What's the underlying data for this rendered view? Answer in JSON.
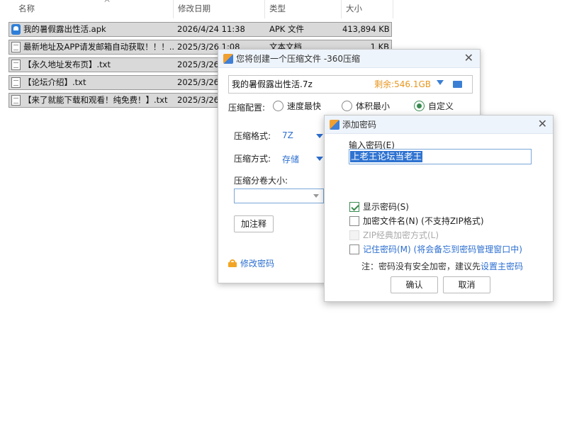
{
  "explorer": {
    "columns": {
      "name": "名称",
      "modified": "修改日期",
      "type": "类型",
      "size": "大小"
    },
    "sort_caret": "^",
    "files": [
      {
        "icon": "apk-file-icon",
        "name": "我的暑假露出性活.apk",
        "modified": "2026/4/24 11:38",
        "type": "APK 文件",
        "size": "413,894 KB"
      },
      {
        "icon": "text-file-icon",
        "name": "最新地址及APP请发邮箱自动获取！！！....",
        "modified": "2025/3/26 1:08",
        "type": "文本文档",
        "size": "1 KB"
      },
      {
        "icon": "text-file-icon",
        "name": "【永久地址发布页】.txt",
        "modified": "2025/3/26",
        "type": "",
        "size": ""
      },
      {
        "icon": "text-file-icon",
        "name": "【论坛介绍】.txt",
        "modified": "2025/3/26",
        "type": "",
        "size": ""
      },
      {
        "icon": "text-file-icon",
        "name": "【来了就能下载和观看！纯免费！】.txt",
        "modified": "2025/3/26",
        "type": "",
        "size": ""
      }
    ]
  },
  "compress_dialog": {
    "title": "您将创建一个压缩文件 -360压缩",
    "close": "✕",
    "archive_name": "我的暑假露出性活.7z",
    "free_space": "剩余:546.1GB",
    "config_label": "压缩配置:",
    "options": [
      {
        "label": "速度最快",
        "selected": false
      },
      {
        "label": "体积最小",
        "selected": false
      },
      {
        "label": "自定义",
        "selected": true
      }
    ],
    "format_label": "压缩格式:",
    "format_value": "7Z",
    "method_label": "压缩方式:",
    "method_value": "存储",
    "volume_label": "压缩分卷大小:",
    "comment_button": "加注释",
    "change_password": "修改密码"
  },
  "password_dialog": {
    "title": "添加密码",
    "close": "✕",
    "input_label": "输入密码(E)",
    "password_value": "上老王论坛当老王",
    "checkboxes": [
      {
        "label": "显示密码(S)",
        "checked": true,
        "disabled": false
      },
      {
        "label": "加密文件名(N) (不支持ZIP格式)",
        "checked": false,
        "disabled": false
      },
      {
        "label": "ZIP经典加密方式(L)",
        "checked": false,
        "disabled": true
      },
      {
        "label": "记住密码(M) (将会备忘到密码管理窗口中)",
        "checked": false,
        "disabled": false
      }
    ],
    "note_prefix": "注：密码没有安全加密，建议先",
    "note_link": "设置主密码",
    "ok_button": "确认",
    "cancel_button": "取消"
  },
  "colors": {
    "accent_blue": "#2d6fd0",
    "free_space_orange": "#e8961e",
    "check_green": "#3a8a50",
    "row_selected": "#d9d9d9"
  }
}
